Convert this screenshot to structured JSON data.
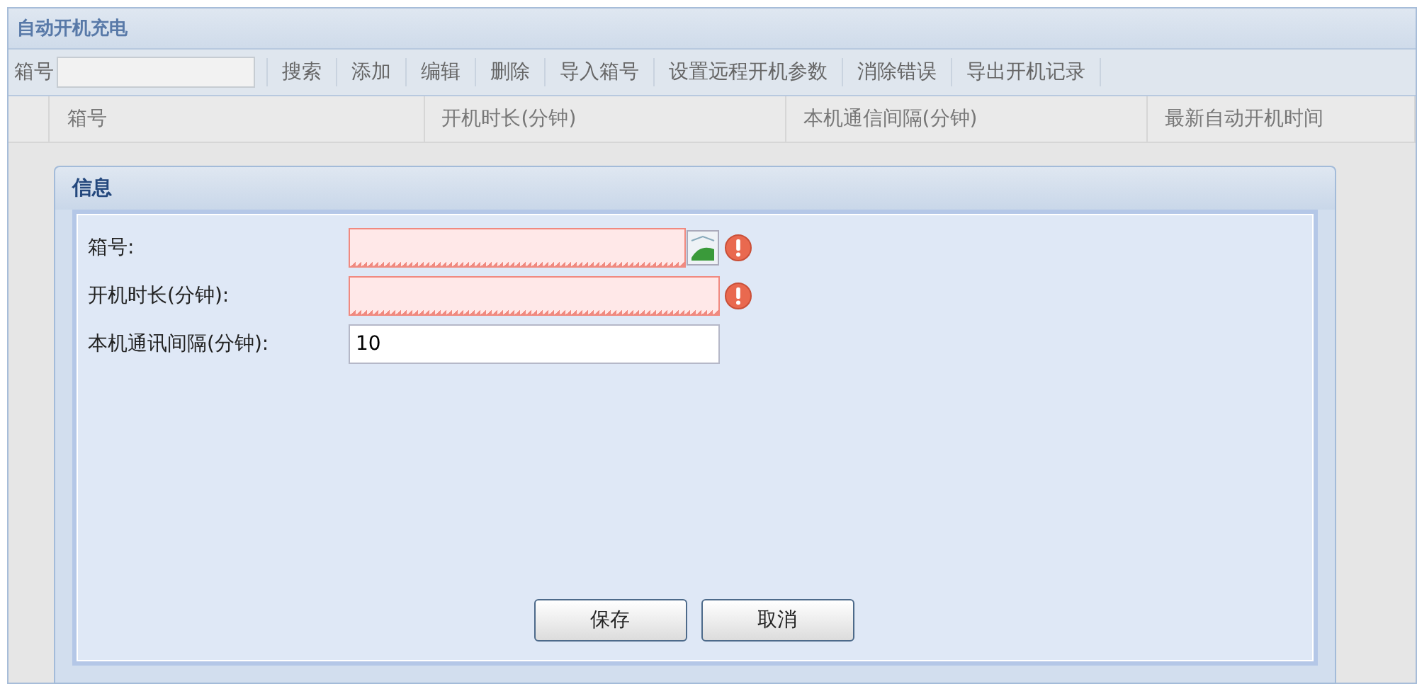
{
  "panel": {
    "title": "自动开机充电"
  },
  "toolbar": {
    "search_label": "箱号",
    "buttons": [
      "搜索",
      "添加",
      "编辑",
      "删除",
      "导入箱号",
      "设置远程开机参数",
      "消除错误",
      "导出开机记录"
    ]
  },
  "table": {
    "columns": [
      "箱号",
      "开机时长(分钟)",
      "本机通信间隔(分钟)",
      "最新自动开机时间"
    ]
  },
  "dialog": {
    "title": "信息",
    "fields": [
      {
        "label": "箱号:",
        "kind": "image",
        "invalid": true
      },
      {
        "label": "开机时长(分钟):",
        "kind": "text",
        "invalid": true
      },
      {
        "label": "本机通讯间隔(分钟):",
        "kind": "text",
        "invalid": false,
        "value": "10"
      }
    ],
    "buttons": [
      "保存",
      "取消"
    ]
  }
}
